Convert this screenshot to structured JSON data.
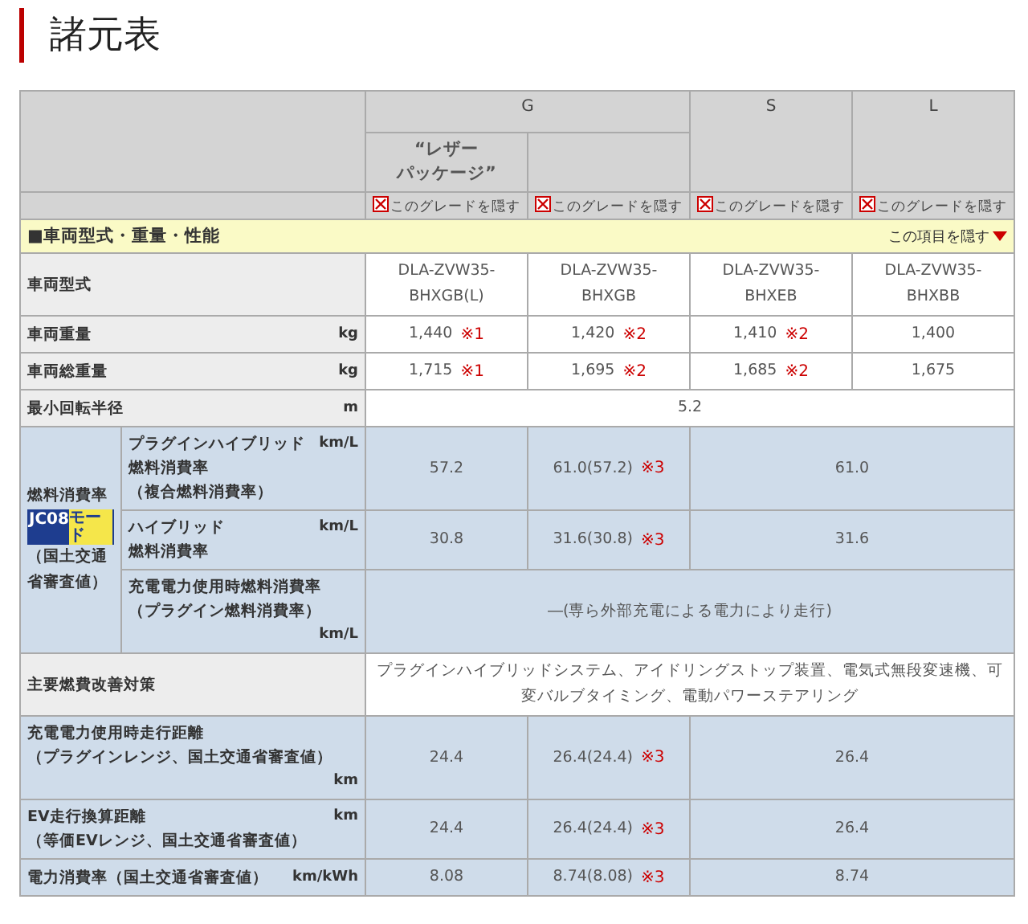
{
  "title": "諸元表",
  "grade_groups": [
    {
      "name": "G",
      "subcolumns": [
        {
          "kind": "labeled",
          "lines": [
            "“レザー",
            "パッケージ”"
          ]
        },
        {
          "kind": "blank"
        }
      ]
    },
    {
      "name": "S",
      "subcolumns": [
        {
          "kind": "plain"
        }
      ]
    },
    {
      "name": "L",
      "subcolumns": [
        {
          "kind": "plain"
        }
      ]
    }
  ],
  "hide_links": [
    "このグレードを隠す",
    "このグレードを隠す",
    "このグレードを隠す",
    "このグレードを隠す"
  ],
  "section": {
    "title": "■車両型式・重量・性能",
    "toggle": "この項目を隠す",
    "expanded": true
  },
  "rows": [
    {
      "kind": "simple",
      "shaded": false,
      "label_lines": [
        {
          "text": "車両型式"
        }
      ],
      "values": [
        {
          "lines": [
            "DLA-ZVW35-",
            "BHXGB(L)"
          ]
        },
        {
          "lines": [
            "DLA-ZVW35-",
            "BHXGB"
          ]
        },
        {
          "lines": [
            "DLA-ZVW35-",
            "BHXEB"
          ]
        },
        {
          "lines": [
            "DLA-ZVW35-",
            "BHXBB"
          ]
        }
      ]
    },
    {
      "kind": "simple",
      "shaded": false,
      "label_lines": [
        {
          "text": "車両重量",
          "unit": "kg"
        }
      ],
      "values": [
        {
          "lines": [
            "1,440"
          ],
          "note": "※1"
        },
        {
          "lines": [
            "1,420"
          ],
          "note": "※2"
        },
        {
          "lines": [
            "1,410"
          ],
          "note": "※2"
        },
        {
          "lines": [
            "1,400"
          ]
        }
      ]
    },
    {
      "kind": "simple",
      "shaded": false,
      "label_lines": [
        {
          "text": "車両総重量",
          "unit": "kg"
        }
      ],
      "values": [
        {
          "lines": [
            "1,715"
          ],
          "note": "※1"
        },
        {
          "lines": [
            "1,695"
          ],
          "note": "※2"
        },
        {
          "lines": [
            "1,685"
          ],
          "note": "※2"
        },
        {
          "lines": [
            "1,675"
          ]
        }
      ]
    },
    {
      "kind": "simple",
      "shaded": false,
      "label_lines": [
        {
          "text": "最小回転半径",
          "unit": "m"
        }
      ],
      "values": [
        {
          "lines": [
            "5.2"
          ]
        }
      ]
    },
    {
      "kind": "group",
      "shaded": true,
      "label": "燃料消費率",
      "badge": "JC08",
      "badge_suffix": "モード",
      "note": "（国土交通省審査値）",
      "rows": [
        {
          "label_lines": [
            {
              "text": "プラグインハイブリッド",
              "unit": "km/L"
            },
            {
              "text": "燃料消費率"
            },
            {
              "text": "（複合燃料消費率）"
            }
          ],
          "values": [
            {
              "lines": [
                "57.2"
              ]
            },
            {
              "lines": [
                "61.0(57.2)"
              ],
              "note": "※3"
            },
            {
              "lines": [
                "61.0"
              ]
            }
          ]
        },
        {
          "label_lines": [
            {
              "text": "ハイブリッド",
              "unit": "km/L"
            },
            {
              "text": "燃料消費率"
            }
          ],
          "values": [
            {
              "lines": [
                "30.8"
              ]
            },
            {
              "lines": [
                "31.6(30.8)"
              ],
              "note": "※3"
            },
            {
              "lines": [
                "31.6"
              ]
            }
          ]
        },
        {
          "label_lines": [
            {
              "text": "充電電力使用時燃料消費率"
            },
            {
              "text": "（プラグイン燃料消費率）"
            },
            {
              "unit": "km/L"
            }
          ],
          "values": [
            {
              "lines": [
                "―(専ら外部充電による電力により走行)"
              ]
            }
          ]
        }
      ]
    },
    {
      "kind": "simple",
      "shaded": false,
      "label_lines": [
        {
          "text": "主要燃費改善対策"
        }
      ],
      "values": [
        {
          "lines": [
            "プラグインハイブリッドシステム、アイドリングストップ装置、電気式無段変速機、可変バルブタイミング、電動パワーステアリング"
          ]
        }
      ]
    },
    {
      "kind": "simple",
      "shaded": true,
      "label_lines": [
        {
          "text": "充電電力使用時走行距離"
        },
        {
          "text": "（プラグインレンジ、国土交通省審査値）"
        },
        {
          "unit": "km"
        }
      ],
      "values": [
        {
          "lines": [
            "24.4"
          ]
        },
        {
          "lines": [
            "26.4(24.4)"
          ],
          "note": "※3"
        },
        {
          "lines": [
            "26.4"
          ]
        }
      ]
    },
    {
      "kind": "simple",
      "shaded": true,
      "label_lines": [
        {
          "text": "EV走行換算距離",
          "unit": "km"
        },
        {
          "text": "（等価EVレンジ、国土交通省審査値）"
        }
      ],
      "values": [
        {
          "lines": [
            "24.4"
          ]
        },
        {
          "lines": [
            "26.4(24.4)"
          ],
          "note": "※3"
        },
        {
          "lines": [
            "26.4"
          ]
        }
      ]
    },
    {
      "kind": "simple",
      "shaded": true,
      "label_lines": [
        {
          "text": "電力消費率（国土交通省審査値）",
          "unit": "km/kWh"
        }
      ],
      "values": [
        {
          "lines": [
            "8.08"
          ]
        },
        {
          "lines": [
            "8.74(8.08)"
          ],
          "note": "※3"
        },
        {
          "lines": [
            "8.74"
          ]
        }
      ]
    }
  ]
}
